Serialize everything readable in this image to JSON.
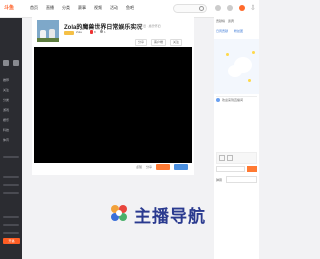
{
  "topbar": {
    "logo": "斗鱼",
    "nav": [
      "首页",
      "直播",
      "分类",
      "赛事",
      "视频",
      "活动",
      "鱼吧"
    ],
    "download_icon": "download-icon"
  },
  "sidebar": {
    "items": [
      "推荐",
      "关注",
      "分类",
      "游戏",
      "娱乐",
      "科技",
      "体育",
      "",
      "",
      "",
      "",
      "",
      "",
      ""
    ],
    "open_button": "开播"
  },
  "room": {
    "title": "Zola的魔兽世界日常娱乐实况",
    "subtitle": "魔兽怀旧 · 魔兽怀旧",
    "streamer": "Zola",
    "hot": "8",
    "viewers": "1",
    "actions": [
      "分享",
      "客户端",
      "关注"
    ]
  },
  "player_controls": {
    "like_label": "点赞",
    "share_label": "分享"
  },
  "right_panel": {
    "tabs": [
      "贡献榜",
      "贵宾"
    ],
    "links": [
      "日周贡献",
      "粉丝团"
    ],
    "welcome": "欢迎来到直播间",
    "chat_label": "弹幕"
  },
  "watermark": {
    "text": "主播导航"
  },
  "colors": {
    "accent": "#ff5d23",
    "sidebar_bg": "#2b2c31",
    "player_bg": "#000000",
    "watermark_blue": "#2a3a8f"
  }
}
